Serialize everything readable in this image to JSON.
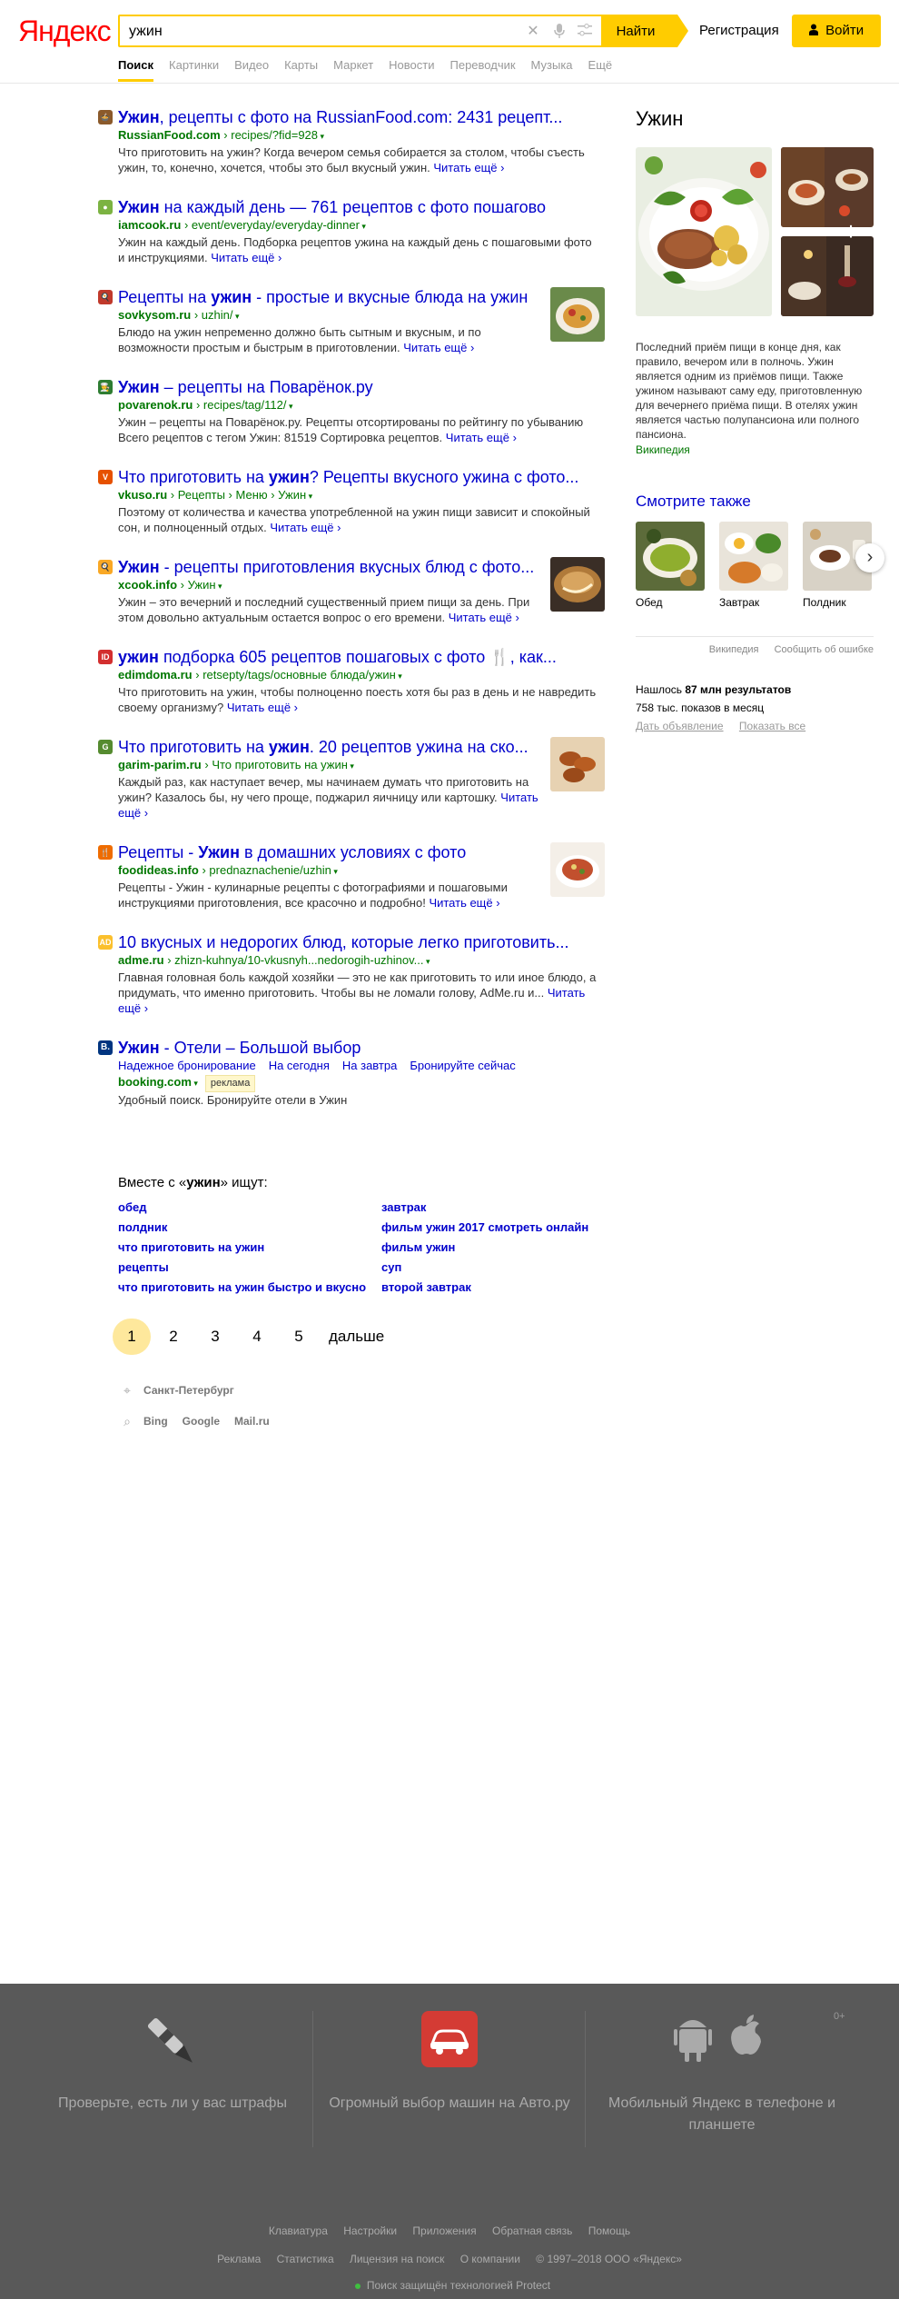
{
  "header": {
    "logo": "Яндекс",
    "search_value": "ужин",
    "search_button": "Найти",
    "register": "Регистрация",
    "login": "Войти",
    "tabs": [
      "Поиск",
      "Картинки",
      "Видео",
      "Карты",
      "Маркет",
      "Новости",
      "Переводчик",
      "Музыка",
      "Ещё"
    ]
  },
  "results": [
    {
      "favicon": "🍲",
      "title_pre": "",
      "title_b": "Ужин",
      "title_post": ", рецепты с фото на RussianFood.com: 2431 рецепт...",
      "host": "RussianFood.com",
      "path": "recipes/?fid=928",
      "snippet": "Что приготовить на ужин? Когда вечером семья собирается за столом, чтобы съесть ужин, то, конечно, хочется, чтобы это был вкусный ужин.",
      "more": "Читать ещё"
    },
    {
      "favicon": "●",
      "title_pre": "",
      "title_b": "Ужин",
      "title_post": " на каждый день — 761 рецептов с фото пошагово",
      "host": "iamcook.ru",
      "path": "event/everyday/everyday-dinner",
      "snippet": "Ужин на каждый день. Подборка рецептов ужина на каждый день с пошаговыми фото и инструкциями.",
      "more": "Читать ещё"
    },
    {
      "favicon": "🍳",
      "title_pre": "Рецепты на ",
      "title_b": "ужин",
      "title_post": " - простые и вкусные блюда на ужин",
      "host": "sovkysom.ru",
      "path": "uzhin/",
      "snippet": "Блюдо на ужин непременно должно быть сытным и вкусным, и по возможности простым и быстрым в приготовлении.",
      "more": "Читать ещё"
    },
    {
      "favicon": "👨‍🍳",
      "title_pre": "",
      "title_b": "Ужин",
      "title_post": " – рецепты на Поварёнок.ру",
      "host": "povarenok.ru",
      "path": "recipes/tag/112/",
      "snippet": "Ужин – рецепты на Поварёнок.ру. Рецепты отсортированы по рейтингу по убыванию Всего рецептов с тегом Ужин: 81519 Сортировка рецептов.",
      "more": "Читать ещё"
    },
    {
      "favicon": "V",
      "title_pre": "Что приготовить на ",
      "title_b": "ужин",
      "title_post": "? Рецепты вкусного ужина с фото...",
      "host": "vkuso.ru",
      "path": "Рецепты › Меню › Ужин",
      "snippet": "Поэтому от количества и качества употребленной на ужин пищи зависит и спокойный сон, и полноценный отдых.",
      "more": "Читать ещё"
    },
    {
      "favicon": "🍳",
      "title_pre": "",
      "title_b": "Ужин",
      "title_post": " - рецепты приготовления вкусных блюд с фото...",
      "host": "xcook.info",
      "path": "Ужин",
      "snippet": "Ужин – это вечерний и последний существенный прием пищи за день. При этом довольно актуальным остается вопрос о его времени.",
      "more": "Читать ещё"
    },
    {
      "favicon": "ID",
      "title_pre": "",
      "title_b": "ужин",
      "title_post": " подборка 605 рецептов пошаговых с фото 🍴, как...",
      "host": "edimdoma.ru",
      "path": "retsepty/tags/основные блюда/ужин",
      "snippet": "Что приготовить на ужин, чтобы полноценно поесть хотя бы раз в день и не навредить своему организму?",
      "more": "Читать ещё"
    },
    {
      "favicon": "G",
      "title_pre": "Что приготовить на ",
      "title_b": "ужин",
      "title_post": ". 20 рецептов ужина на ско...",
      "host": "garim-parim.ru",
      "path": "Что приготовить на ужин",
      "snippet": "Каждый раз, как наступает вечер, мы начинаем думать что приготовить на ужин? Казалось бы, ну чего проще, поджарил яичницу или картошку.",
      "more": "Читать ещё"
    },
    {
      "favicon": "🍴",
      "title_pre": "Рецепты - ",
      "title_b": "Ужин",
      "title_post": " в домашних условиях с фото",
      "host": "foodideas.info",
      "path": "prednaznachenie/uzhin",
      "snippet": "Рецепты - Ужин - кулинарные рецепты с фотографиями и пошаговыми инструкциями приготовления, все красочно и подробно!",
      "more": "Читать ещё"
    },
    {
      "favicon": "AD",
      "title_pre": "10 вкусных и недорогих блюд, которые легко приготовить...",
      "title_b": "",
      "title_post": "",
      "host": "adme.ru",
      "path": "zhizn-kuhnya/10-vkusnyh...nedorogih-uzhinov...",
      "snippet": "Главная головная боль каждой хозяйки — это не как приготовить то или иное блюдо, а придумать, что именно приготовить. Чтобы вы не ломали голову, AdMe.ru и...",
      "more": "Читать ещё"
    }
  ],
  "ad": {
    "favicon": "B.",
    "title_b": "Ужин",
    "title_post": " - Отели – Большой выбор",
    "links": [
      "Надежное бронирование",
      "На сегодня",
      "На завтра",
      "Бронируйте сейчас"
    ],
    "host": "booking.com",
    "badge": "реклама",
    "snippet": "Удобный поиск. Бронируйте отели в Ужин"
  },
  "related": {
    "title_pre": "Вместе с «",
    "title_b": "ужин",
    "title_post": "» ищут:",
    "left": [
      "обед",
      "полдник",
      "что приготовить на ужин",
      "рецепты",
      "что приготовить на ужин быстро и вкусно"
    ],
    "right": [
      "завтрак",
      "фильм ужин 2017 смотреть онлайн",
      "фильм ужин",
      "суп",
      "второй завтрак"
    ]
  },
  "pager": {
    "pages": [
      "1",
      "2",
      "3",
      "4",
      "5"
    ],
    "next": "дальше"
  },
  "bottom": {
    "city": "Санкт-Петербург",
    "engines": [
      "Bing",
      "Google",
      "Mail.ru"
    ]
  },
  "side": {
    "title": "Ужин",
    "description": "Последний приём пищи в конце дня, как правило, вечером или в полночь. Ужин является одним из приёмов пищи. Также ужином называют саму еду, приготовленную для вечернего приёма пищи. В отелях ужин является частью полупансиона или полного пансиона.",
    "source": "Википедия",
    "see_also": "Смотрите также",
    "see_items": [
      "Обед",
      "Завтрак",
      "Полдник"
    ],
    "wiki": "Википедия",
    "report": "Сообщить об ошибке",
    "found_pre": "Нашлось ",
    "found_b": "87 млн результатов",
    "shows": "758 тыс. показов в месяц",
    "give_ad": "Дать объявление",
    "show_all": "Показать все"
  },
  "footer": {
    "promo1": "Проверьте, есть ли у вас штрафы",
    "promo2": "Огромный выбор машин на Авто.ру",
    "promo3": "Мобильный Яндекс в телефоне и планшете",
    "zero": "0+",
    "row1": [
      "Клавиатура",
      "Настройки",
      "Приложения",
      "Обратная связь",
      "Помощь"
    ],
    "row2": [
      "Реклама",
      "Статистика",
      "Лицензия на поиск",
      "О компании",
      "© 1997–2018 ООО «Яндекс»"
    ],
    "protect": "Поиск защищён технологией Protect"
  }
}
